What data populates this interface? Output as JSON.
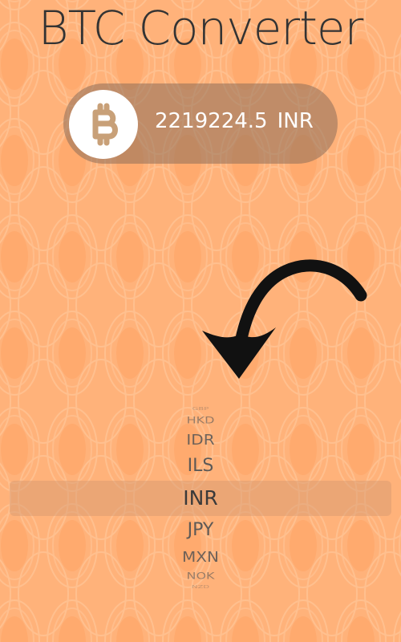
{
  "app": {
    "title": "BTC Converter"
  },
  "converter": {
    "value": "2219224.5",
    "currency": "INR",
    "coin_icon": "bitcoin-icon"
  },
  "decoration": {
    "arrow_icon": "curved-arrow-down-left-icon"
  },
  "picker": {
    "items": [
      "GBP",
      "HKD",
      "IDR",
      "ILS",
      "INR",
      "JPY",
      "MXN",
      "NOK",
      "NZD"
    ],
    "selected": "INR"
  },
  "colors": {
    "background": "#ffb27a",
    "title_text": "#333333",
    "pill": "#8c6e5a",
    "coin_symbol": "#c8a078",
    "arrow": "#111111"
  }
}
